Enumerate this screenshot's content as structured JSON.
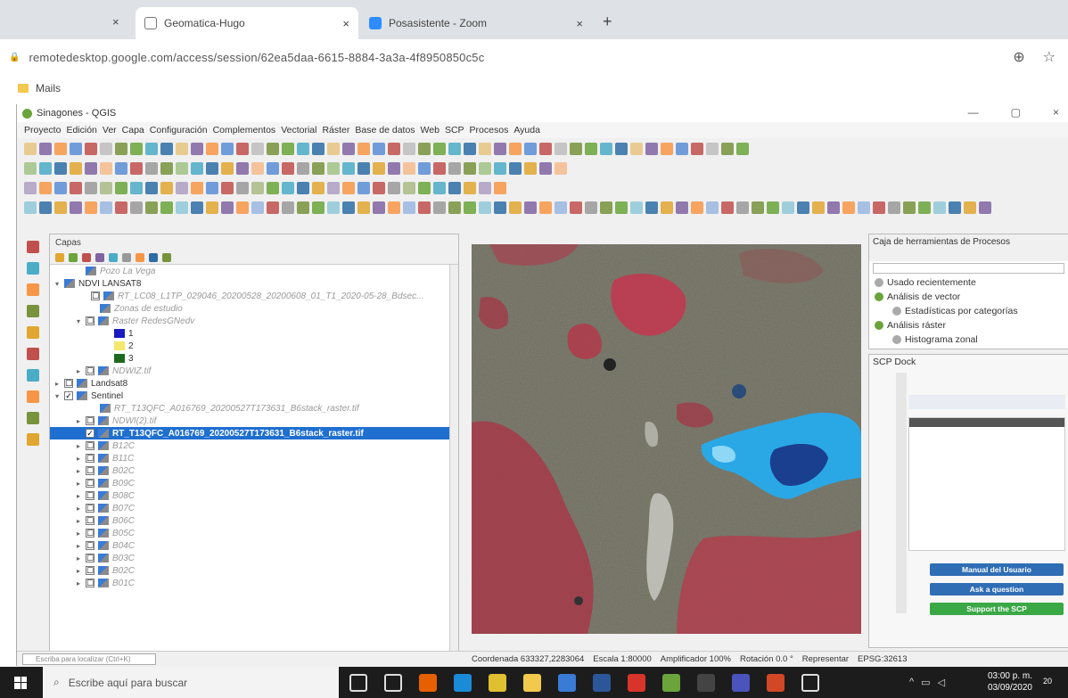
{
  "browser": {
    "tabs": [
      {
        "title": "Geomatica-Hugo",
        "close": "×"
      },
      {
        "title": "Posasistente - Zoom",
        "close": "×"
      }
    ],
    "first_tab_close": "×",
    "new_tab": "+",
    "url": "remotedesktop.google.com/access/session/62ea5daa-6615-8884-3a3a-4f8950850c5c",
    "bookmark": "Mails"
  },
  "qgis": {
    "title": "Sinagones - QGIS",
    "window_controls": [
      "—",
      "▢",
      "×"
    ],
    "menu": [
      "Proyecto",
      "Edición",
      "Ver",
      "Capa",
      "Configuración",
      "Complementos",
      "Vectorial",
      "Ráster",
      "Base de datos",
      "Web",
      "SCP",
      "Procesos",
      "Ayuda"
    ],
    "layers_panel": {
      "title": "Capas",
      "items": [
        {
          "text": "Pozo La Vega",
          "state": "muted",
          "indent": 30,
          "check": ""
        },
        {
          "text": "NDVI LANSAT8",
          "state": "normal",
          "indent": 6,
          "check": "",
          "expand": "▾"
        },
        {
          "text": "RT_LC08_L1TP_029046_20200528_20200608_01_T1_2020-05-28_Bdsec...",
          "state": "muted",
          "indent": 36,
          "check": "☐"
        },
        {
          "text": "Zonas de estudio",
          "state": "muted",
          "indent": 46,
          "check": ""
        },
        {
          "text": "Raster RedesGNedv",
          "state": "muted",
          "indent": 30,
          "check": "☐",
          "expand": "▾"
        },
        {
          "text": "1",
          "state": "normal",
          "indent": 62,
          "check": ""
        },
        {
          "text": "2",
          "state": "normal",
          "indent": 62,
          "check": ""
        },
        {
          "text": "3",
          "state": "normal",
          "indent": 62,
          "check": ""
        },
        {
          "text": "NDWIZ.tif",
          "state": "muted",
          "indent": 30,
          "check": "☐",
          "expand": "▸"
        },
        {
          "text": "Landsat8",
          "state": "normal",
          "indent": 6,
          "check": "☐",
          "expand": "▸"
        },
        {
          "text": "Sentinel",
          "state": "normal",
          "indent": 6,
          "check": "✓",
          "expand": "▾"
        },
        {
          "text": "RT_T13QFC_A016769_20200527T173631_B6stack_raster.tif",
          "state": "muted",
          "indent": 46,
          "check": ""
        },
        {
          "text": "NDWI(2).tif",
          "state": "muted",
          "indent": 30,
          "check": "☐",
          "expand": "▸"
        },
        {
          "text": "RT_T13QFC_A016769_20200527T173631_B6stack_raster.tif",
          "state": "selected",
          "indent": 30,
          "check": "✓"
        },
        {
          "text": "B12C",
          "state": "muted",
          "indent": 30,
          "check": "☐",
          "expand": "▸"
        },
        {
          "text": "B11C",
          "state": "muted",
          "indent": 30,
          "check": "☐",
          "expand": "▸"
        },
        {
          "text": "B02C",
          "state": "muted",
          "indent": 30,
          "check": "☐",
          "expand": "▸"
        },
        {
          "text": "B09C",
          "state": "muted",
          "indent": 30,
          "check": "☐",
          "expand": "▸"
        },
        {
          "text": "B08C",
          "state": "muted",
          "indent": 30,
          "check": "☐",
          "expand": "▸"
        },
        {
          "text": "B07C",
          "state": "muted",
          "indent": 30,
          "check": "☐",
          "expand": "▸"
        },
        {
          "text": "B06C",
          "state": "muted",
          "indent": 30,
          "check": "☐",
          "expand": "▸"
        },
        {
          "text": "B05C",
          "state": "muted",
          "indent": 30,
          "check": "☐",
          "expand": "▸"
        },
        {
          "text": "B04C",
          "state": "muted",
          "indent": 30,
          "check": "☐",
          "expand": "▸"
        },
        {
          "text": "B03C",
          "state": "muted",
          "indent": 30,
          "check": "☐",
          "expand": "▸"
        },
        {
          "text": "B02C",
          "state": "muted",
          "indent": 30,
          "check": "☐",
          "expand": "▸"
        },
        {
          "text": "B01C",
          "state": "muted",
          "indent": 30,
          "check": "☐",
          "expand": "▸"
        }
      ]
    },
    "processing": {
      "title": "Caja de herramientas de Procesos",
      "items": [
        {
          "text": "Usado recientemente",
          "indent": 6
        },
        {
          "text": "Análisis de vector",
          "indent": 6
        },
        {
          "text": "Estadísticas por categorías",
          "indent": 26
        },
        {
          "text": "Análisis ráster",
          "indent": 6
        },
        {
          "text": "Histograma zonal",
          "indent": 26
        }
      ]
    },
    "scp": {
      "title": "SCP Dock",
      "buttons": [
        {
          "label": "Manual del Usuario",
          "color": "#2f6db5"
        },
        {
          "label": "Ask a question",
          "color": "#2f6db5"
        },
        {
          "label": "Support the SCP",
          "color": "#3aa845"
        }
      ]
    },
    "status": {
      "locator": "Escriba para localizar (Ctrl+K)",
      "coordinate": "Coordenada  633327,2283064",
      "scale": "Escala 1:80000",
      "magnifier": "Amplificador  100%",
      "rotation": "Rotación  0.0 °",
      "render": "Representar",
      "crs": "EPSG:32613"
    }
  },
  "taskbar": {
    "search_placeholder": "Escribe aquí para buscar",
    "time": "03:00 p. m.",
    "date": "03/09/2020",
    "notification_count": "20"
  }
}
